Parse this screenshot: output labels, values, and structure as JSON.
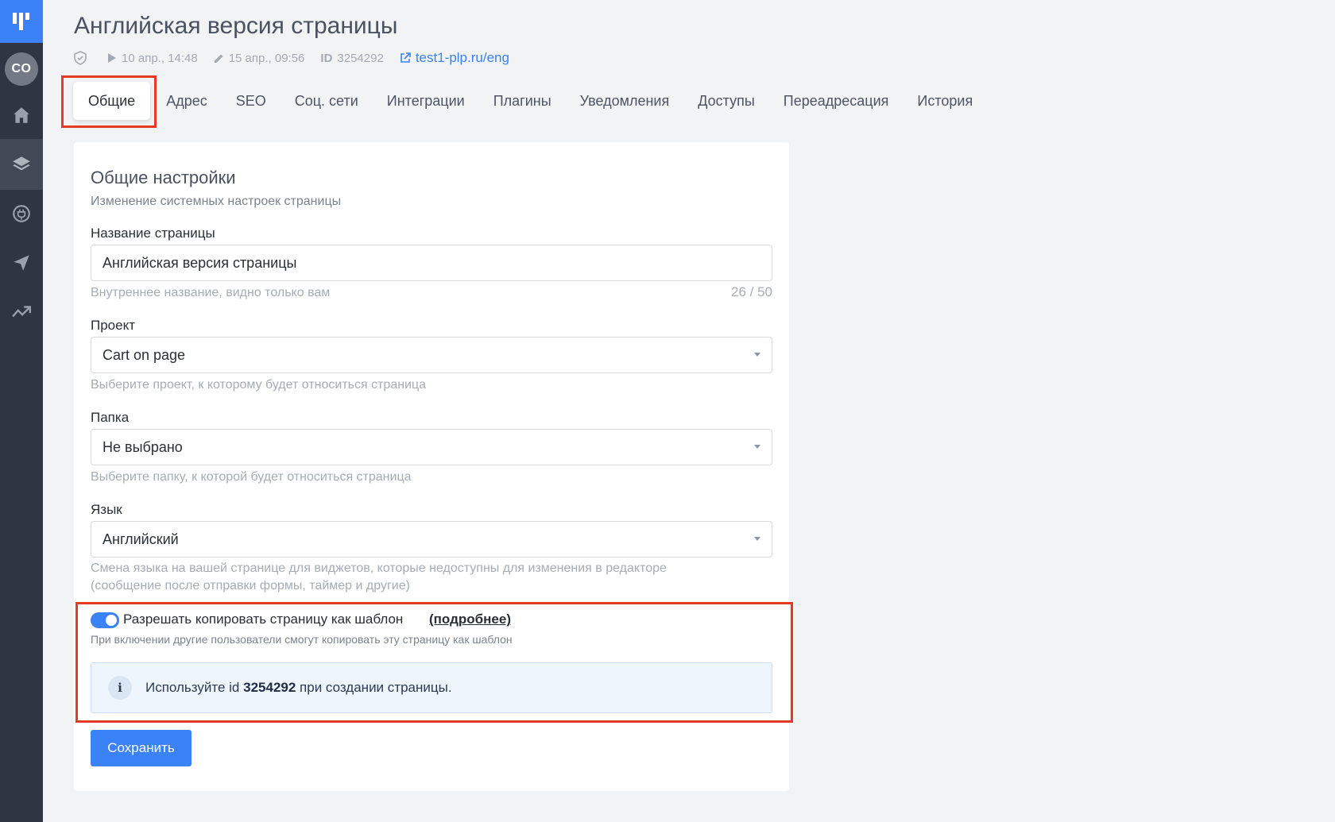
{
  "sidebar": {
    "avatar_initials": "CO",
    "items": [
      {
        "icon": "home-icon"
      },
      {
        "icon": "layers-icon",
        "active": true
      },
      {
        "icon": "plug-icon"
      },
      {
        "icon": "send-icon"
      },
      {
        "icon": "analytics-icon"
      }
    ]
  },
  "header": {
    "title": "Английская версия страницы",
    "published": "10 апр., 14:48",
    "edited": "15 апр., 09:56",
    "id_label": "ID",
    "id_value": "3254292",
    "url": "test1-plp.ru/eng"
  },
  "tabs": [
    {
      "label": "Общие",
      "active": true
    },
    {
      "label": "Адрес"
    },
    {
      "label": "SEO"
    },
    {
      "label": "Соц. сети"
    },
    {
      "label": "Интеграции"
    },
    {
      "label": "Плагины"
    },
    {
      "label": "Уведомления"
    },
    {
      "label": "Доступы"
    },
    {
      "label": "Переадресация"
    },
    {
      "label": "История"
    }
  ],
  "form": {
    "section_title": "Общие настройки",
    "section_subtitle": "Изменение системных настроек страницы",
    "name": {
      "label": "Название страницы",
      "value": "Английская версия страницы",
      "hint": "Внутреннее название, видно только вам",
      "counter": "26 / 50"
    },
    "project": {
      "label": "Проект",
      "value": "Cart on page",
      "hint": "Выберите проект, к которому будет относиться страница"
    },
    "folder": {
      "label": "Папка",
      "value": "Не выбрано",
      "hint": "Выберите папку, к которой будет относиться страница"
    },
    "language": {
      "label": "Язык",
      "value": "Английский",
      "hint_line1": "Смена языка на вашей странице для виджетов, которые недоступны для изменения в редакторе",
      "hint_line2": "(сообщение после отправки формы, таймер и другие)"
    },
    "template": {
      "toggle_on": true,
      "label": "Разрешать копировать страницу как шаблон",
      "more": "(подробнее)",
      "hint": "При включении другие пользователи смогут копировать эту страницу как шаблон",
      "info_prefix": "Используйте id",
      "info_id": "3254292",
      "info_suffix": "при создании страницы."
    },
    "save_label": "Сохранить"
  },
  "colors": {
    "accent": "#3b82f6",
    "highlight_outline": "#e53a25",
    "sidebar_bg": "#2f3543"
  }
}
